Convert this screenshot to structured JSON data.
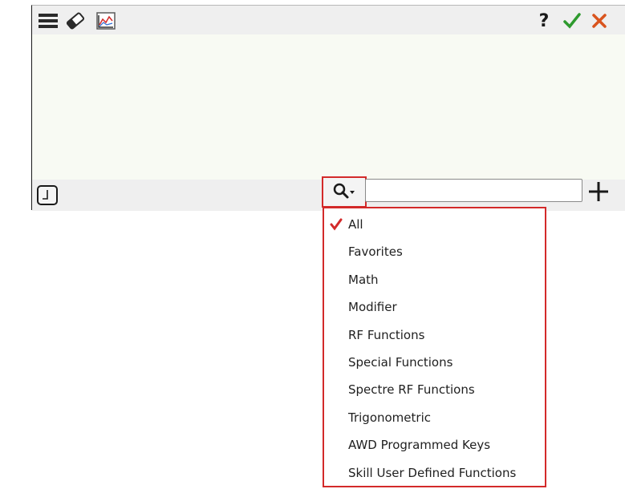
{
  "toolbar": {
    "left_icons": [
      "menu-icon",
      "eraser-icon",
      "chart-icon"
    ],
    "right_icons": [
      "help-icon",
      "check-icon",
      "close-icon"
    ],
    "help_label": "?"
  },
  "bottom_bar": {
    "clock_icon": "clock-icon",
    "search_icon": "search-dropdown-icon",
    "search_value": "",
    "add_icon": "plus-icon"
  },
  "filter_menu": {
    "selected": "All",
    "items": [
      {
        "label": "All",
        "checked": true
      },
      {
        "label": "Favorites",
        "checked": false
      },
      {
        "label": "Math",
        "checked": false
      },
      {
        "label": "Modifier",
        "checked": false
      },
      {
        "label": "RF Functions",
        "checked": false
      },
      {
        "label": "Special Functions",
        "checked": false
      },
      {
        "label": "Spectre RF Functions",
        "checked": false
      },
      {
        "label": "Trigonometric",
        "checked": false
      },
      {
        "label": "AWD Programmed Keys",
        "checked": false
      },
      {
        "label": "Skill User Defined Functions",
        "checked": false
      }
    ]
  },
  "colors": {
    "highlight_border": "#d32a2a",
    "check_green": "#2e9a2e",
    "close_orange": "#d9541e",
    "menu_check": "#d32a2a"
  }
}
